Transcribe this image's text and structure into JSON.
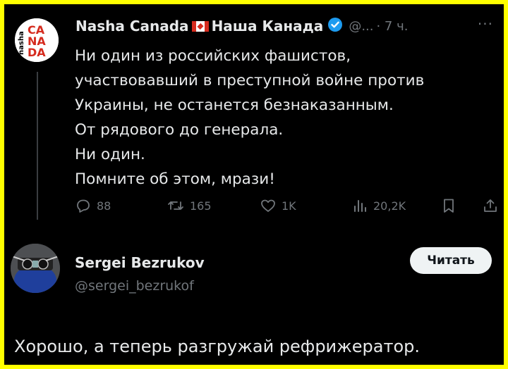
{
  "tweet": {
    "author_name": "Nasha Canada",
    "author_name_ru": "Наша Канада",
    "handle": "@...",
    "time": "· 7 ч.",
    "more": "···",
    "avatar_text": [
      "CA",
      "NA",
      "DA"
    ],
    "avatar_side_text": "nasha",
    "lines": [
      "Ни один из российских фашистов,",
      "участвовавший в преступной войне против",
      "Украины, не останется безнаказанным.",
      "От рядового до генерала.",
      "Ни один.",
      "Помните об этом, мрази!"
    ],
    "actions": {
      "replies": "88",
      "retweets": "165",
      "likes": "1K",
      "views": "20,2K"
    }
  },
  "reply_card": {
    "name": "Sergei Bezrukov",
    "handle": "@sergei_bezrukof",
    "follow_label": "Читать",
    "text": "Хорошо, а теперь разгружай рефрижератор."
  },
  "colors": {
    "frame": "#ffff00",
    "background": "#000000",
    "text": "#e7e9ea",
    "muted": "#71767b",
    "verified": "#1d9bf0",
    "flag_red": "#d52b1e"
  }
}
